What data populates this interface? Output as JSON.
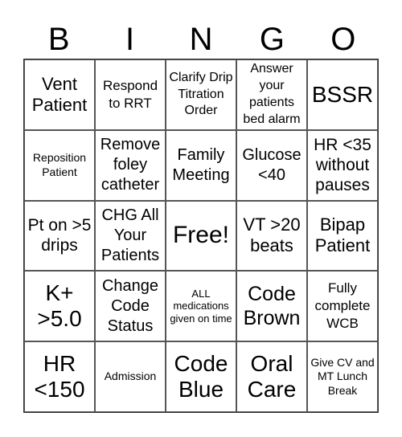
{
  "header": [
    "B",
    "I",
    "N",
    "G",
    "O"
  ],
  "cells": [
    "Vent Patient",
    "Respond to RRT",
    "Clarify Drip Titration Order",
    "Answer your patients bed alarm",
    "BSSR",
    "Reposition Patient",
    "Remove foley catheter",
    "Family Meeting",
    "Glucose <40",
    "HR <35 without pauses",
    "Pt on >5 drips",
    "CHG All Your Patients",
    "Free!",
    "VT >20 beats",
    "Bipap Patient",
    "K+ >5.0",
    "Change Code Status",
    "ALL medications given on time",
    "Code Brown",
    "Fully complete WCB",
    "HR <150",
    "Admission",
    "Code Blue",
    "Oral Care",
    "Give CV and MT Lunch Break"
  ]
}
